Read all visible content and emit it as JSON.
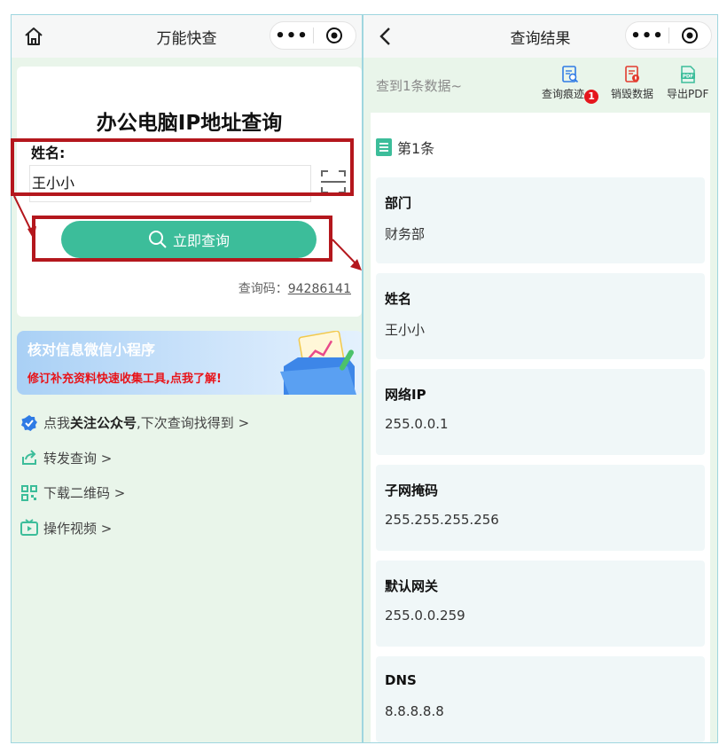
{
  "left": {
    "nav_title": "万能快查",
    "capsule_more": "•••",
    "app_title": "办公电脑IP地址查询",
    "name_label": "姓名:",
    "name_value": "王小小",
    "query_button": "立即查询",
    "query_code_label": "查询码：",
    "query_code": "94286141",
    "banner": {
      "title": "核对信息微信小程序",
      "subtitle": "修订补充资料快速收集工具,点我了解!"
    },
    "menu": [
      {
        "pre": "点我",
        "bold": "关注公众号",
        "post": ",下次查询找得到 >",
        "icon": "verified-icon"
      },
      {
        "pre": "转发查询 >",
        "bold": "",
        "post": "",
        "icon": "share-icon"
      },
      {
        "pre": "下载二维码 >",
        "bold": "",
        "post": "",
        "icon": "qrcode-icon"
      },
      {
        "pre": "操作视频 >",
        "bold": "",
        "post": "",
        "icon": "video-icon"
      }
    ]
  },
  "right": {
    "nav_title": "查询结果",
    "capsule_more": "•••",
    "result_count": "查到1条数据~",
    "tools": {
      "history": "查询痕迹",
      "history_badge": "1",
      "destroy": "销毁数据",
      "export": "导出PDF"
    },
    "record_title": "第1条",
    "fields": [
      {
        "label": "部门",
        "value": "财务部"
      },
      {
        "label": "姓名",
        "value": "王小小"
      },
      {
        "label": "网络IP",
        "value": "255.0.0.1"
      },
      {
        "label": "子网掩码",
        "value": "255.255.255.256"
      },
      {
        "label": "默认网关",
        "value": "255.0.0.259"
      },
      {
        "label": "DNS",
        "value": "8.8.8.8.8"
      }
    ]
  },
  "colors": {
    "accent": "#3cbd9a",
    "highlight_red": "#b4171d",
    "page_bg": "#e9f5ea",
    "field_bg": "#f0f7f8"
  }
}
